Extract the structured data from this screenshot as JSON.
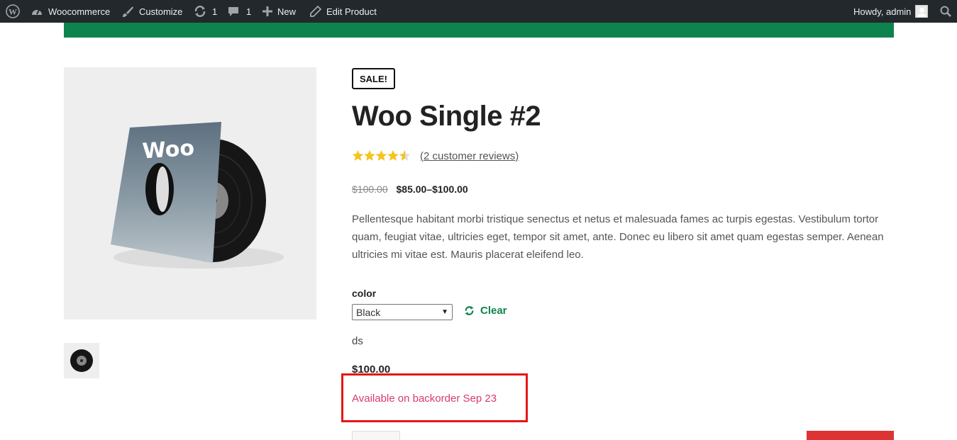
{
  "adminbar": {
    "site_name": "Woocommerce",
    "customize": "Customize",
    "updates_count": "1",
    "comments_count": "1",
    "new_label": "New",
    "edit_label": "Edit Product",
    "howdy": "Howdy, admin"
  },
  "product": {
    "badge": "SALE!",
    "title": "Woo Single #2",
    "rating": 4.5,
    "reviews_link": "(2 customer reviews)",
    "regular_price": "$100.00",
    "sale_price": "$85.00–$100.00",
    "description": "Pellentesque habitant morbi tristique senectus et netus et malesuada fames ac turpis egestas. Vestibulum tortor quam, feugiat vitae, ultricies eget, tempor sit amet, ante. Donec eu libero sit amet quam egestas semper. Aenean ultricies mi vitae est. Mauris placerat eleifend leo.",
    "image_text": "Woo"
  },
  "variations": {
    "attribute_label": "color",
    "selected_value": "Black",
    "clear_label": "Clear",
    "variation_description": "ds",
    "variation_price": "$100.00",
    "stock_status": "Available on backorder Sep 23"
  },
  "colors": {
    "adminbar_bg": "#23282d",
    "accent_green": "#0f834d",
    "star_gold": "#f5c518",
    "stock_pink": "#d93a6e",
    "highlight_red": "#e51717",
    "button_red": "#dd3333"
  }
}
